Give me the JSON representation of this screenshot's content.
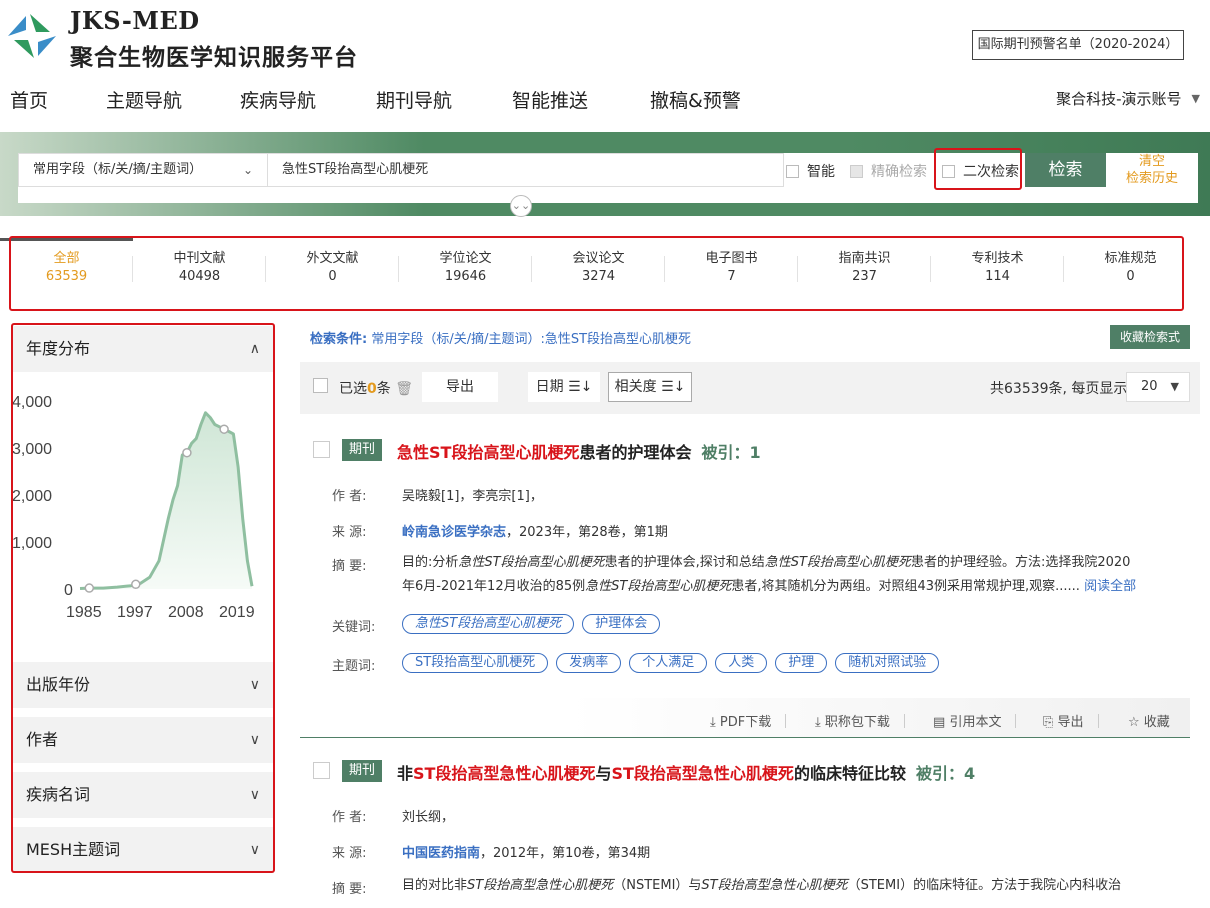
{
  "header": {
    "logo_en": "JKS-MED",
    "logo_cn": "聚合生物医学知识服务平台",
    "warning_list": "国际期刊预警名单（2020-2024）",
    "account": "聚合科技-演示账号"
  },
  "nav": [
    "首页",
    "主题导航",
    "疾病导航",
    "期刊导航",
    "智能推送",
    "撤稿&预警"
  ],
  "search": {
    "field": "常用字段（标/关/摘/主题词）",
    "query": "急性ST段抬高型心肌梗死",
    "opt_smart": "智能",
    "opt_exact": "精确检索",
    "opt_secondary": "二次检索",
    "button": "检索",
    "clear_line1": "清空",
    "clear_line2": "检索历史"
  },
  "tabs": [
    {
      "label": "全部",
      "count": "63539"
    },
    {
      "label": "中刊文献",
      "count": "40498"
    },
    {
      "label": "外文文献",
      "count": "0"
    },
    {
      "label": "学位论文",
      "count": "19646"
    },
    {
      "label": "会议论文",
      "count": "3274"
    },
    {
      "label": "电子图书",
      "count": "7"
    },
    {
      "label": "指南共识",
      "count": "237"
    },
    {
      "label": "专利技术",
      "count": "114"
    },
    {
      "label": "标准规范",
      "count": "0"
    }
  ],
  "sidebar": {
    "year_dist": "年度分布",
    "sections": [
      "出版年份",
      "作者",
      "疾病名词",
      "MESH主题词"
    ]
  },
  "chart_data": {
    "type": "area",
    "x": [
      1985,
      1987,
      1990,
      1993,
      1996,
      1998,
      2000,
      2002,
      2004,
      2005,
      2006,
      2007,
      2008,
      2009,
      2010,
      2011,
      2012,
      2013,
      2014,
      2015,
      2016,
      2017,
      2018,
      2019,
      2020,
      2021,
      2022
    ],
    "values": [
      10,
      20,
      20,
      40,
      70,
      120,
      250,
      600,
      1500,
      1900,
      2200,
      2850,
      2900,
      3100,
      3200,
      3500,
      3750,
      3650,
      3500,
      3450,
      3400,
      3350,
      3300,
      2600,
      1500,
      600,
      60
    ],
    "y_ticks": [
      "0",
      "1,000",
      "2,000",
      "3,000",
      "4,000"
    ],
    "x_ticks": [
      "1985",
      "1997",
      "2008",
      "2019"
    ],
    "ylim": [
      0,
      4000
    ],
    "xlim": [
      1985,
      2022
    ],
    "color": "#8fbfa0"
  },
  "results": {
    "condition_label": "检索条件:",
    "condition_value": "常用字段（标/关/摘/主题词）:急性ST段抬高型心肌梗死",
    "save_query": "收藏检索式",
    "selected_prefix": "已选",
    "selected_count": "0",
    "selected_suffix": "条",
    "export": "导出",
    "sort_date": "日期 ☰↓",
    "sort_relevance": "相关度 ☰↓",
    "total": "共63539条, 每页显示",
    "per_page": "20"
  },
  "item1": {
    "badge": "期刊",
    "title_red": "急性ST段抬高型心肌梗死",
    "title_rest": "患者的护理体会",
    "cite": "被引：1",
    "lbl_author": "作 者:",
    "author": "吴晓毅[1]，李亮宗[1]，",
    "lbl_source": "来 源:",
    "journal": "岭南急诊医学杂志",
    "source_rest": "，2023年，第28卷，第1期",
    "lbl_abstract": "摘 要:",
    "abs_1a": "目的:分析",
    "abs_1b": "急性ST段抬高型心肌梗死",
    "abs_1c": "患者的护理体会,探讨和总结",
    "abs_1d": "急性ST段抬高型心肌梗死",
    "abs_1e": "患者的护理经验。方法:选择我院2020",
    "abs_2a": "年6月-2021年12月收治的85例",
    "abs_2b": "急性ST段抬高型心肌梗死",
    "abs_2c": "患者,将其随机分为两组。对照组43例采用常规护理,观察...... ",
    "read_more": "阅读全部",
    "lbl_keywords": "关键词:",
    "keywords": [
      "急性ST段抬高型心肌梗死",
      "护理体会"
    ],
    "lbl_subjects": "主题词:",
    "subjects": [
      "ST段抬高型心肌梗死",
      "发病率",
      "个人满足",
      "人类",
      "护理",
      "随机对照试验"
    ]
  },
  "actions": [
    "PDF下载",
    "职称包下载",
    "引用本文",
    "导出",
    "收藏"
  ],
  "item2": {
    "badge": "期刊",
    "t1": "非",
    "t2": "ST段抬高型急性心肌梗死",
    "t3": "与",
    "t4": "ST段抬高型急性心肌梗死",
    "t5": "的临床特征比较",
    "cite": "被引：4",
    "lbl_author": "作 者:",
    "author": "刘长纲，",
    "lbl_source": "来 源:",
    "journal": "中国医药指南",
    "source_rest": "，2012年，第10卷，第34期",
    "lbl_abstract": "摘 要:",
    "abs_1a": "目的对比非",
    "abs_1b": "ST段抬高型急性心肌梗死",
    "abs_1c": "（NSTEMI）与",
    "abs_1d": "ST段抬高型急性心肌梗死",
    "abs_1e": "（STEMI）的临床特征。方法于我院心内科收治"
  }
}
